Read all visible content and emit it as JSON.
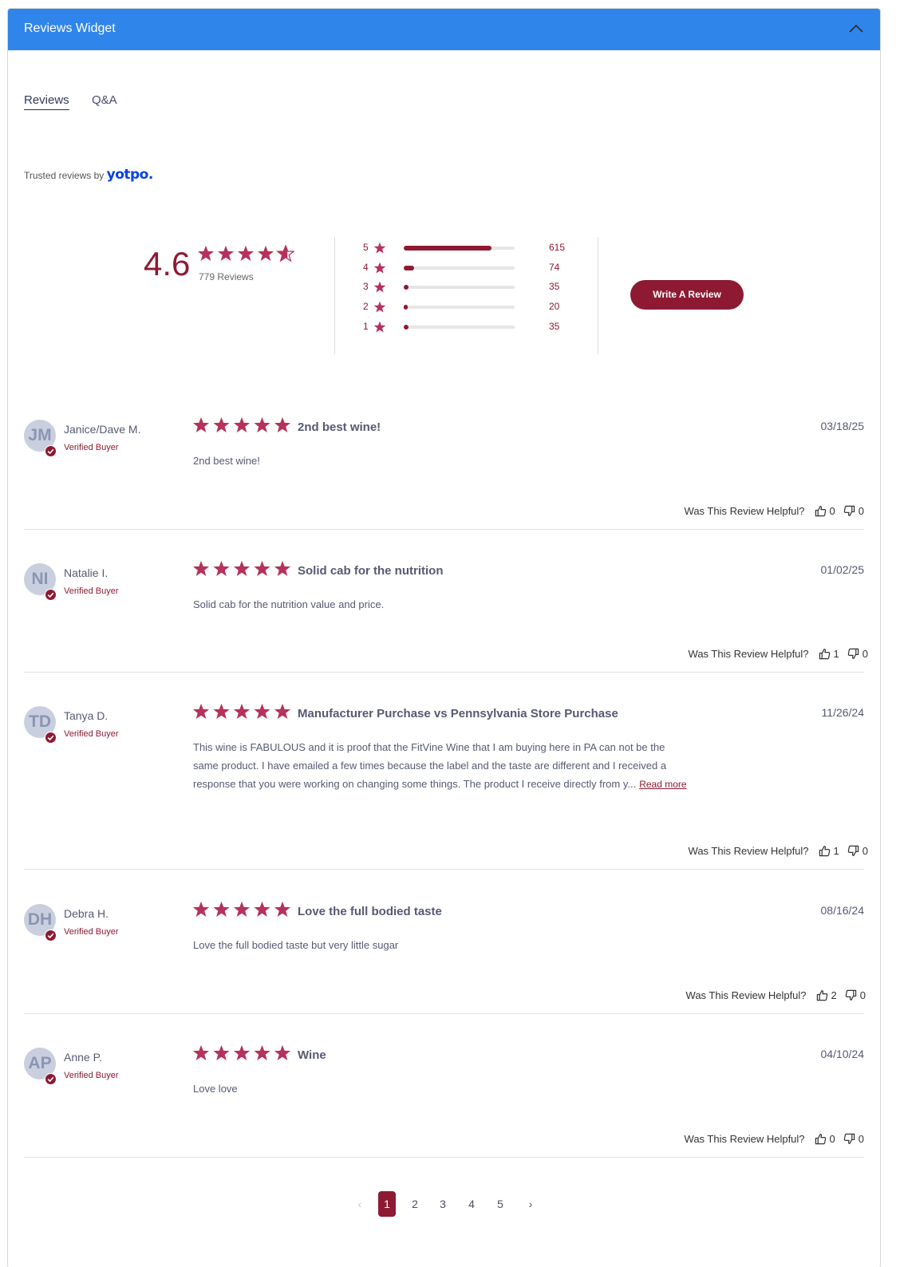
{
  "header": {
    "title": "Reviews Widget",
    "collapse_icon": "chevron-up-icon"
  },
  "tabs": [
    {
      "label": "Reviews",
      "active": true
    },
    {
      "label": "Q&A",
      "active": false
    }
  ],
  "branding": {
    "trusted_text": "Trusted reviews by",
    "logo_text": "yotpo."
  },
  "summary": {
    "average": "4.6",
    "average_value": 4.6,
    "total_reviews": "779 Reviews",
    "distribution": [
      {
        "stars": "5",
        "count": "615",
        "fraction": 0.79
      },
      {
        "stars": "4",
        "count": "74",
        "fraction": 0.095
      },
      {
        "stars": "3",
        "count": "35",
        "fraction": 0.045
      },
      {
        "stars": "2",
        "count": "20",
        "fraction": 0.026
      },
      {
        "stars": "1",
        "count": "35",
        "fraction": 0.045
      }
    ],
    "write_review_label": "Write A Review"
  },
  "reviews": [
    {
      "initials": "JM",
      "name": "Janice/Dave M.",
      "verified": "Verified Buyer",
      "rating": 5,
      "title": "2nd best wine!",
      "date": "03/18/25",
      "body": "2nd best wine!",
      "read_more": "",
      "helpful_label": "Was This Review Helpful?",
      "up": "0",
      "down": "0"
    },
    {
      "initials": "NI",
      "name": "Natalie I.",
      "verified": "Verified Buyer",
      "rating": 5,
      "title": "Solid cab for the nutrition",
      "date": "01/02/25",
      "body": "Solid cab for the nutrition value and price.",
      "read_more": "",
      "helpful_label": "Was This Review Helpful?",
      "up": "1",
      "down": "0"
    },
    {
      "initials": "TD",
      "name": "Tanya D.",
      "verified": "Verified Buyer",
      "rating": 5,
      "title": "Manufacturer Purchase vs Pennsylvania Store Purchase",
      "date": "11/26/24",
      "body": "This wine is FABULOUS and it is proof that the FitVine Wine that I am buying here in PA can not be the same product. I have emailed a few times because the label and the taste are different and I received a response that you were working on changing some things. The product I receive directly from y...",
      "read_more": "Read more",
      "helpful_label": "Was This Review Helpful?",
      "up": "1",
      "down": "0"
    },
    {
      "initials": "DH",
      "name": "Debra H.",
      "verified": "Verified Buyer",
      "rating": 5,
      "title": "Love the full bodied taste",
      "date": "08/16/24",
      "body": "Love the full bodied taste but very little sugar",
      "read_more": "",
      "helpful_label": "Was This Review Helpful?",
      "up": "2",
      "down": "0"
    },
    {
      "initials": "AP",
      "name": "Anne P.",
      "verified": "Verified Buyer",
      "rating": 5,
      "title": "Wine",
      "date": "04/10/24",
      "body": "Love love",
      "read_more": "",
      "helpful_label": "Was This Review Helpful?",
      "up": "0",
      "down": "0"
    }
  ],
  "pagination": {
    "prev": "‹",
    "pages": [
      "1",
      "2",
      "3",
      "4",
      "5"
    ],
    "current": "1",
    "next": "›"
  },
  "colors": {
    "header": "#3085ea",
    "accent": "#8d1a32",
    "star": "#b5325a",
    "text": "#4a4a6a"
  },
  "icons": {
    "star": "star-icon",
    "verified": "verified-check-icon",
    "thumb_up": "thumbs-up-icon",
    "thumb_down": "thumbs-down-icon"
  }
}
